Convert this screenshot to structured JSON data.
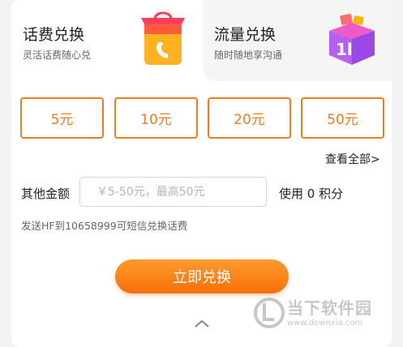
{
  "tabs": [
    {
      "title": "话费兑换",
      "subtitle": "灵活话费随心兑",
      "icon": "phone-shopping-bag-icon"
    },
    {
      "title": "流量兑换",
      "subtitle": "随时随地享沟通",
      "icon": "data-gift-box-icon"
    }
  ],
  "amounts": [
    "5元",
    "10元",
    "20元",
    "50元"
  ],
  "view_all_label": "查看全部>",
  "other_amount": {
    "label": "其他金额",
    "placeholder": "￥5-50元，最高50元",
    "value": ""
  },
  "points_text": "使用 0 积分",
  "sms_tip": "发送HF到10658999可短信兑换话费",
  "exchange_button_label": "立即兑换",
  "watermark": {
    "name": "当下软件园",
    "url": "www.downxia.com"
  },
  "colors": {
    "accent": "#f07c20",
    "button_top": "#ff9b2e",
    "button_bottom": "#f56f0a"
  }
}
